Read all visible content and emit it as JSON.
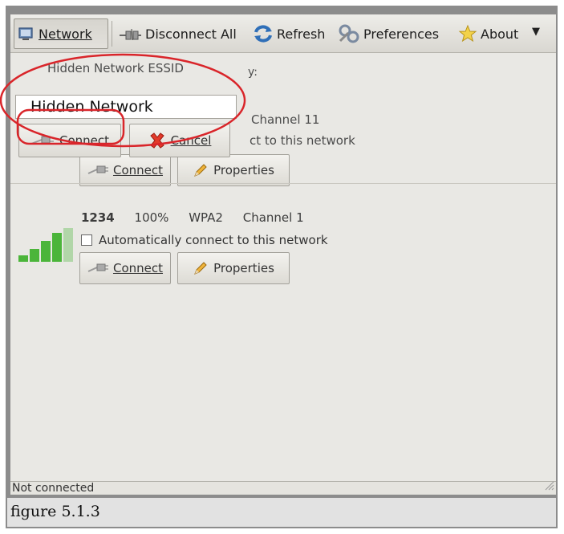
{
  "toolbar": {
    "network_label": "Network",
    "disconnect_all_label": "Disconnect All",
    "refresh_label": "Refresh",
    "preferences_label": "Preferences",
    "about_label": "About",
    "menu_arrow": "▼"
  },
  "hidden_dialog": {
    "essid_label": "Hidden Network ESSID",
    "essid_value": "Hidden Network",
    "connect_label": "Connect",
    "cancel_label": "Cancel"
  },
  "obscured_network": {
    "trailing_label_fragment": "y:",
    "channel": "Channel 11",
    "auto_connect_fragment": "ct to this network",
    "connect_label": "Connect",
    "properties_label": "Properties"
  },
  "network_1234": {
    "essid": "1234",
    "signal": "100%",
    "encryption": "WPA2",
    "channel": "Channel 1",
    "auto_connect_label": "Automatically connect to this network",
    "auto_connect_checked": false,
    "connect_label": "Connect",
    "properties_label": "Properties"
  },
  "status": {
    "text": "Not connected"
  },
  "caption": {
    "text": "figure 5.1.3"
  },
  "colors": {
    "annotation_ellipse": "#d9252a",
    "signal_green": "#4bb53a",
    "window_bg": "#e9e8e4"
  }
}
